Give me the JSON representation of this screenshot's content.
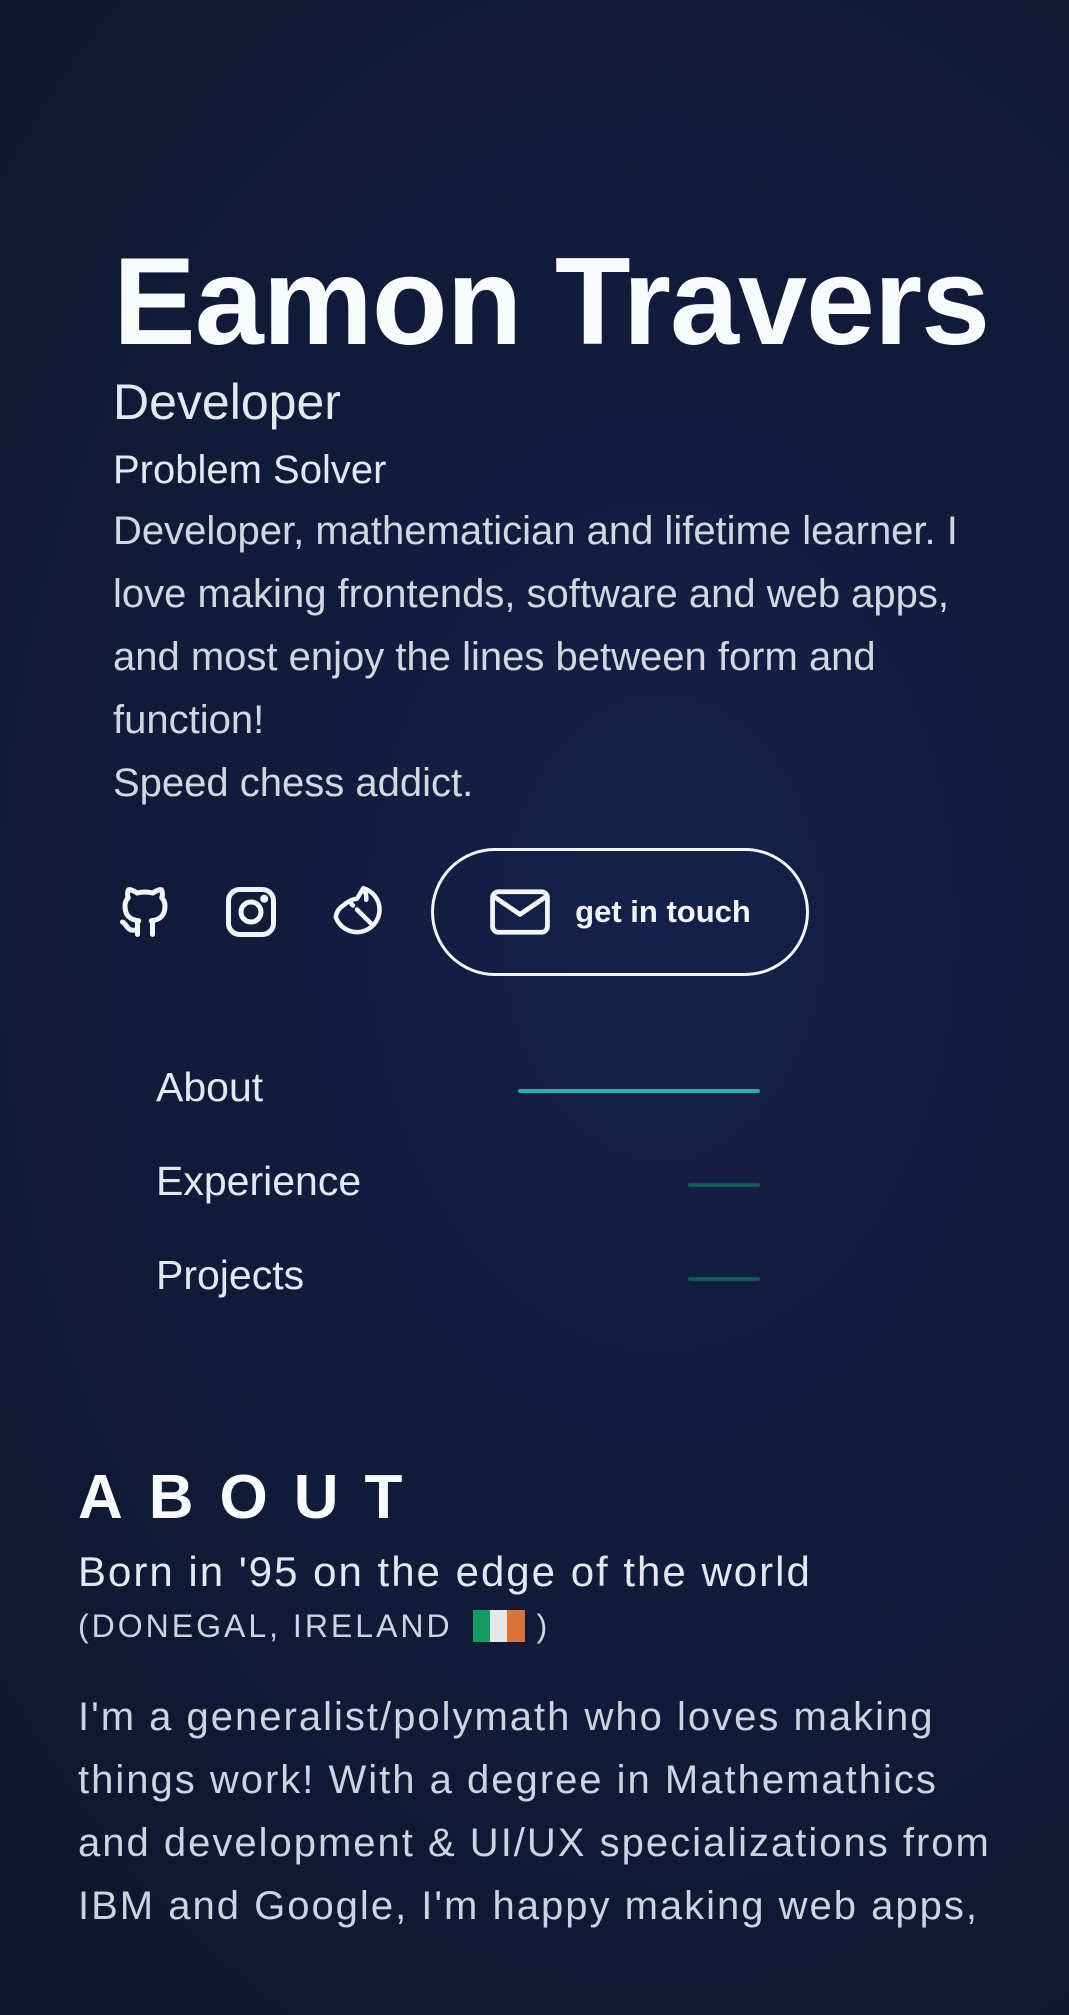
{
  "hero": {
    "name": "Eamon Travers",
    "role_primary": "Developer",
    "role_secondary": "Problem Solver",
    "bio_paragraph": "Developer, mathematician and lifetime learner. I love making frontends, software and web apps, and most enjoy the lines between form and function!",
    "bio_extra": "Speed chess addict."
  },
  "social": {
    "icons": [
      "github-icon",
      "instagram-icon",
      "chess-knight-icon"
    ],
    "cta_icon": "mail-icon",
    "cta_label": "get in touch"
  },
  "nav": {
    "items": [
      {
        "label": "About",
        "active": true
      },
      {
        "label": "Experience",
        "active": false
      },
      {
        "label": "Projects",
        "active": false
      }
    ]
  },
  "about": {
    "heading": "ABOUT",
    "subtitle": "Born in '95 on the edge of the world",
    "location_prefix": "(DONEGAL, IRELAND",
    "location_suffix": ")",
    "flag_colors": [
      "#169b62",
      "#e5e7eb",
      "#d9733a"
    ],
    "body": "I'm a generalist/polymath who loves making things work! With a degree in Mathemathics and development & UI/UX specializations from IBM and Google, I'm happy making web apps,"
  },
  "colors": {
    "background": "#121b3c",
    "accent_active": "#22b3b3",
    "accent_inactive": "#175a55",
    "text": "#e2e8f0"
  }
}
